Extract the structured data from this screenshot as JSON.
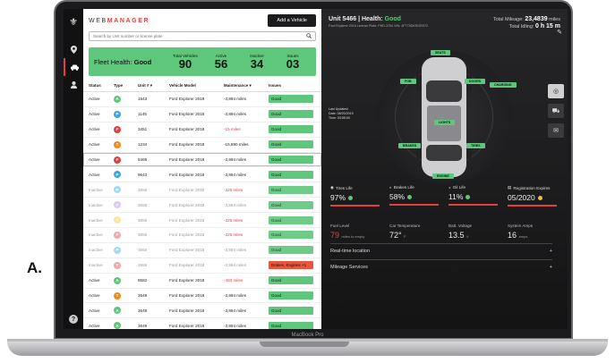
{
  "figure_label": "A.",
  "laptop_model": "MacBook Pro",
  "colors": {
    "good": "#5fc77c",
    "alert": "#e04040",
    "issue_bad": "#e8573c",
    "dark": "#1b1b1d"
  },
  "sidebar": {
    "logo_icon": "brand-mark-icon",
    "items": [
      {
        "icon": "map-pin-icon",
        "glyph": "⬤"
      },
      {
        "icon": "car-icon",
        "glyph": "▣"
      },
      {
        "icon": "user-icon",
        "glyph": "●"
      }
    ],
    "help": "?"
  },
  "header": {
    "brand_prefix": "WEB",
    "brand_suffix": "MANAGER",
    "add_button": "Add a Vehicle"
  },
  "search": {
    "placeholder": "Search by Unit number or license plate"
  },
  "fleet": {
    "label": "Fleet Health:",
    "value": "Good",
    "stats": [
      {
        "label": "Total Vehicles",
        "value": "90"
      },
      {
        "label": "Active",
        "value": "56"
      },
      {
        "label": "Inactive",
        "value": "34"
      },
      {
        "label": "Issues",
        "value": "03"
      }
    ]
  },
  "table": {
    "columns": [
      "Status",
      "Type",
      "Unit # ▾",
      "Vehicle Model",
      "Maintenance ▾",
      "Issues"
    ],
    "rows": [
      {
        "status": "Active",
        "type": "A",
        "color": "#5fc77c",
        "unit": "1843",
        "model": "Ford Explorer 2018",
        "maint": "-3,894 miles",
        "warn": false,
        "issue": "Good",
        "bad": false
      },
      {
        "status": "Active",
        "type": "P",
        "color": "#39a7e0",
        "unit": "1145",
        "model": "Ford Explorer 2018",
        "maint": "-3,894 miles",
        "warn": false,
        "issue": "Good",
        "bad": false
      },
      {
        "status": "Active",
        "type": "F",
        "color": "#e04040",
        "unit": "3451",
        "model": "Ford Explorer 2018",
        "maint": "-15 miles",
        "warn": true,
        "issue": "Good",
        "bad": false
      },
      {
        "status": "Active",
        "type": "T",
        "color": "#f08a1c",
        "unit": "1234",
        "model": "Ford Explorer 2018",
        "maint": "-15,890 miles",
        "warn": false,
        "issue": "Good",
        "bad": false
      },
      {
        "status": "Active",
        "type": "F",
        "color": "#e04040",
        "unit": "5466",
        "model": "Ford Explorer 2018",
        "maint": "-3,894 miles",
        "warn": false,
        "issue": "Good",
        "bad": false,
        "selected": true
      },
      {
        "status": "Active",
        "type": "P",
        "color": "#39a7e0",
        "unit": "9643",
        "model": "Ford Explorer 2018",
        "maint": "-3,894 miles",
        "warn": false,
        "issue": "Good",
        "bad": false
      },
      {
        "status": "Inactive",
        "type": "P",
        "color": "#39a7e0",
        "unit": "3556",
        "model": "Ford Explorer 2018",
        "maint": "-325 miles",
        "warn": true,
        "issue": "Good",
        "bad": false
      },
      {
        "status": "Inactive",
        "type": "P",
        "color": "#a989d8",
        "unit": "3556",
        "model": "Ford Explorer 2018",
        "maint": "-3,894 miles",
        "warn": false,
        "issue": "Good",
        "bad": false
      },
      {
        "status": "Inactive",
        "type": "T",
        "color": "#f0c23a",
        "unit": "3556",
        "model": "Ford Explorer 2018",
        "maint": "-325 miles",
        "warn": true,
        "issue": "Good",
        "bad": false
      },
      {
        "status": "Inactive",
        "type": "F",
        "color": "#e04040",
        "unit": "3556",
        "model": "Ford Explorer 2018",
        "maint": "-325 miles",
        "warn": true,
        "issue": "Good",
        "bad": false
      },
      {
        "status": "Inactive",
        "type": "P",
        "color": "#39a7e0",
        "unit": "3556",
        "model": "Ford Explorer 2018",
        "maint": "-3,894 miles",
        "warn": false,
        "issue": "Good",
        "bad": false
      },
      {
        "status": "Inactive",
        "type": "F",
        "color": "#e04040",
        "unit": "3556",
        "model": "Ford Explorer 2018",
        "maint": "-3,894 miles",
        "warn": false,
        "issue": "Brakes, Engines +1",
        "bad": true
      },
      {
        "status": "Active",
        "type": "A",
        "color": "#5fc77c",
        "unit": "8582",
        "model": "Ford Explorer 2018",
        "maint": "-493 miles",
        "warn": true,
        "issue": "Good",
        "bad": false
      },
      {
        "status": "Active",
        "type": "T",
        "color": "#f08a1c",
        "unit": "3649",
        "model": "Ford Explorer 2018",
        "maint": "-3,894 miles",
        "warn": false,
        "issue": "Good",
        "bad": false
      },
      {
        "status": "Active",
        "type": "A",
        "color": "#5fc77c",
        "unit": "3649",
        "model": "Ford Explorer 2018",
        "maint": "-3,894 miles",
        "warn": false,
        "issue": "Good",
        "bad": false
      },
      {
        "status": "Active",
        "type": "A",
        "color": "#5fc77c",
        "unit": "3649",
        "model": "Ford Explorer 2018",
        "maint": "-3,894 miles",
        "warn": false,
        "issue": "Good",
        "bad": false
      }
    ]
  },
  "detail": {
    "unit": "Unit 5466",
    "health_label": "Health:",
    "health_value": "Good",
    "sub": "Ford Explorer 2018   License Plate: PHD-3794   VIN: 4FT7SDKSGRS72",
    "mileage_label": "Total Mileage:",
    "mileage_value": "23,4839",
    "mileage_unit": "miles",
    "idle_label": "Total Idling:",
    "idle_value": "0 h 15 m",
    "zones": [
      "SEATS",
      "FOB",
      "DOORS",
      "CHARGING",
      "LIGHTS",
      "BRAKES",
      "TIRES",
      "ENGINE"
    ],
    "legend": [
      "Last Updated:",
      "Date: 08/20/2019",
      "Time: 03:55:00"
    ],
    "side_buttons": [
      {
        "icon": "steering-wheel-icon",
        "label": "Car Overview"
      },
      {
        "icon": "car-diagnostics-icon",
        "label": "Diagnostics"
      },
      {
        "icon": "message-icon",
        "label": "Messages"
      }
    ],
    "gauges": [
      {
        "icon": "tire-icon",
        "label": "Tires Life",
        "value": "97%",
        "dot": "green"
      },
      {
        "icon": "brake-icon",
        "label": "Brakes Life",
        "value": "58%",
        "dot": "green"
      },
      {
        "icon": "oil-icon",
        "label": "Oil Life",
        "value": "11%",
        "dot": "green"
      },
      {
        "icon": "registration-icon",
        "label": "Registration Expires",
        "value": "05/2020",
        "dot": "yellow"
      }
    ],
    "metrics": [
      {
        "label": "Fuel Level",
        "value": "79",
        "unit": "miles to empty",
        "red": true
      },
      {
        "label": "Car Temperature",
        "value": "72°",
        "unit": "F",
        "red": false
      },
      {
        "label": "Batt. Voltage",
        "value": "13.5",
        "unit": "V",
        "red": false
      },
      {
        "label": "System Amps",
        "value": "16",
        "unit": "amps",
        "red": false
      }
    ],
    "accordions": [
      "Real-time location",
      "Mileage Services"
    ],
    "accordion_icon": "+"
  }
}
